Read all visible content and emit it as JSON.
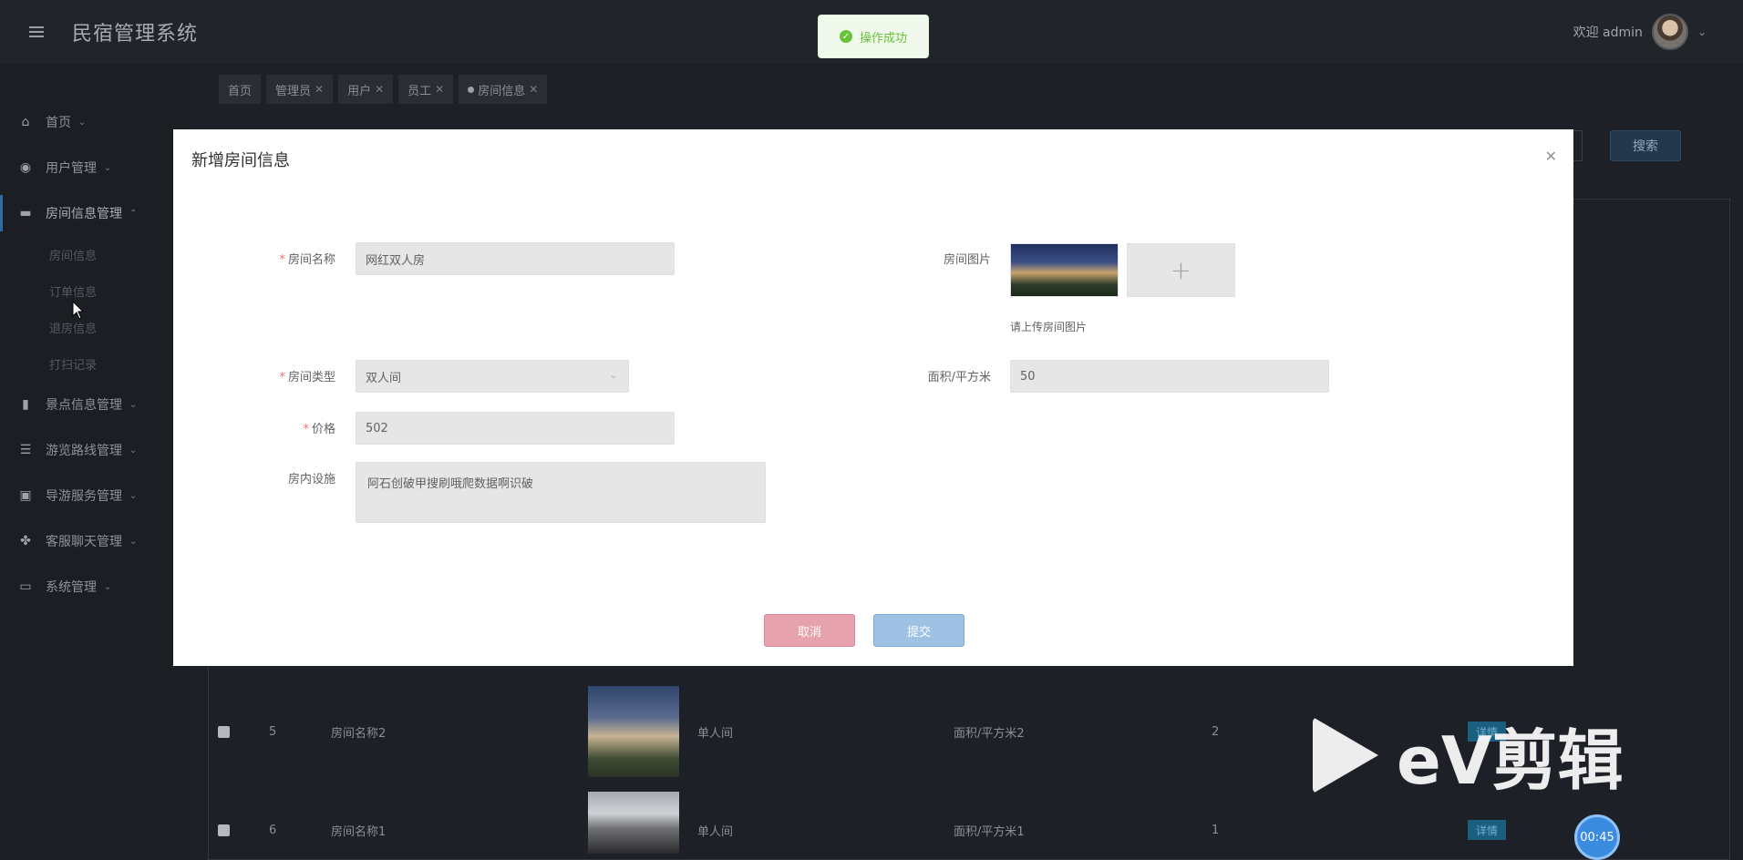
{
  "header": {
    "app_title": "民宿管理系统",
    "welcome": "欢迎 admin"
  },
  "toast": {
    "message": "操作成功"
  },
  "sidebar": {
    "items": [
      {
        "label": "首页",
        "icon": "home-icon"
      },
      {
        "label": "用户管理",
        "icon": "compass-icon"
      },
      {
        "label": "房间信息管理",
        "icon": "bed-icon"
      },
      {
        "label": "景点信息管理",
        "icon": "book-icon"
      },
      {
        "label": "游览路线管理",
        "icon": "layers-icon"
      },
      {
        "label": "导游服务管理",
        "icon": "image-icon"
      },
      {
        "label": "客服聊天管理",
        "icon": "grid-icon"
      },
      {
        "label": "系统管理",
        "icon": "window-icon"
      }
    ],
    "sub_items": [
      "房间信息",
      "订单信息",
      "退房信息",
      "打扫记录"
    ]
  },
  "tabs": [
    {
      "label": "首页"
    },
    {
      "label": "管理员"
    },
    {
      "label": "用户"
    },
    {
      "label": "员工"
    },
    {
      "label": "房间信息"
    }
  ],
  "toolbar": {
    "search_label": "搜索"
  },
  "table": {
    "rows": [
      {
        "no": "5",
        "name": "房间名称2",
        "type": "单人间",
        "area": "面积/平方米2",
        "count": "2",
        "detail": "详情"
      },
      {
        "no": "6",
        "name": "房间名称1",
        "type": "单人间",
        "area": "面积/平方米1",
        "count": "1",
        "detail": "详情"
      }
    ]
  },
  "dialog": {
    "title": "新增房间信息",
    "fields": {
      "room_name": {
        "label": "房间名称",
        "value": "网红双人房"
      },
      "room_image": {
        "label": "房间图片",
        "hint": "请上传房间图片"
      },
      "room_type": {
        "label": "房间类型",
        "value": "双人间"
      },
      "area": {
        "label": "面积/平方米",
        "value": "50"
      },
      "price": {
        "label": "价格",
        "value": "502"
      },
      "facilities": {
        "label": "房内设施",
        "value": "阿石创破甲搜刷哦爬数据啊识破"
      }
    },
    "cancel_label": "取消",
    "submit_label": "提交"
  },
  "watermark": {
    "text": "eV剪辑",
    "timer": "00:45"
  }
}
